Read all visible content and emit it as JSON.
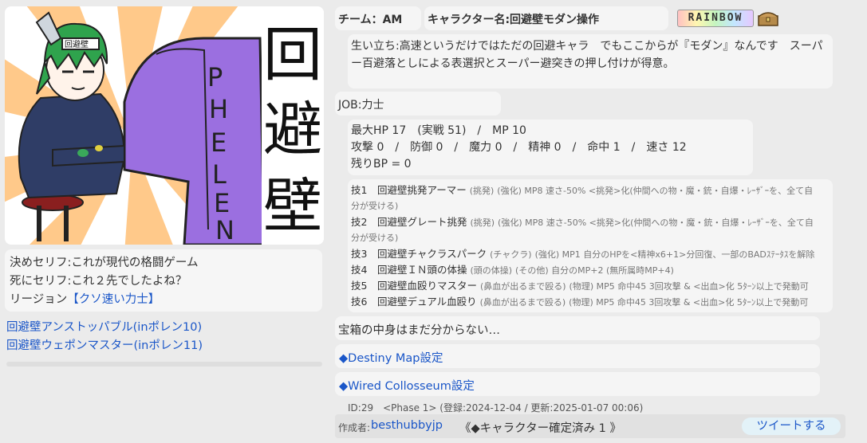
{
  "header": {
    "team": "チーム：AM",
    "character_name": "キャラクター名:回避壁モダン操作",
    "rank_badge": "RAINBOW"
  },
  "portrait": {
    "title_glyphs": [
      "回",
      "避",
      "壁"
    ],
    "vertical_word": [
      "P",
      "H",
      "E",
      "L",
      "E",
      "N"
    ],
    "headband_text": "回避壁"
  },
  "profile": {
    "bio": "生い立ち:高速というだけではただの回避キャラ　でもここからが『モダン』なんです　スーパー百避落としによる表選択とスーパー避突きの押し付けが得意。"
  },
  "quotes": {
    "win_quote": "決めセリフ:これが現代の格闘ゲーム",
    "death_quote": "死にセリフ:これ２先でしたよね？",
    "region_label": "リージョン",
    "region_value": "【クソ速い力士】"
  },
  "links": [
    "回避壁アンストッパブル(inポレン10)",
    "回避壁ウェポンマスター(inポレン11)"
  ],
  "job": "JOB:力士",
  "stats": {
    "line1": "最大HP 17　(実戦 51)　/　MP 10",
    "line2": "攻撃 0　/　防御 0　/　魔力 0　/　精神 0　/　命中 1　/　速さ 12",
    "line3": "残りBP = 0"
  },
  "skills": [
    {
      "label": "技1",
      "name": "回避壁挑発アーマー",
      "type": "(挑発)",
      "desc": "(強化) MP8 速さ-50% <挑発>化(仲間への物・魔・銃・自爆・ﾚｰｻﾞｰを、全て自",
      "wrap": "分が受ける)"
    },
    {
      "label": "技2",
      "name": "回避壁グレート挑発",
      "type": "(挑発)",
      "desc": "(強化) MP8 速さ-50% <挑発>化(仲間への物・魔・銃・自爆・ﾚｰｻﾞｰを、全て自",
      "wrap": "分が受ける)"
    },
    {
      "label": "技3",
      "name": "回避壁チャクラスパーク",
      "type": "(チャクラ)",
      "desc": "(強化) MP1 自分のHPを<精神x6+1>分回復、一部のBADｽﾃｰﾀｽを解除",
      "wrap": ""
    },
    {
      "label": "技4",
      "name": "回避壁ＩＮ頭の体操",
      "type": "(頭の体操)",
      "desc": "(その他) 自分のMP+2 (無所属時MP+4)",
      "wrap": ""
    },
    {
      "label": "技5",
      "name": "回避壁血殴りマスター",
      "type": "(鼻血が出るまで殴る)",
      "desc": "(物理) MP5 命中45 3回攻撃 & <出血>化 5ﾀｰﾝ以上で発動可",
      "wrap": ""
    },
    {
      "label": "技6",
      "name": "回避壁デュアル血殴り",
      "type": "(鼻血が出るまで殴る)",
      "desc": "(物理) MP5 命中45 3回攻撃 & <出血>化 5ﾀｰﾝ以上で発動可",
      "wrap": ""
    }
  ],
  "treasure": "宝箱の中身はまだ分からない…",
  "sections": [
    "◆Destiny Map設定",
    "◆Wired Collosseum設定"
  ],
  "meta": {
    "id_line": "ID:29　<Phase 1> (登録:2024-12-04 / 更新:2025-01-07 00:06)",
    "author_label": "作成者:",
    "author": "besthubbyjp",
    "status": "《◆キャラクター確定済み 1 》",
    "tweet": "ツイートする"
  },
  "colors": {
    "link": "#1a56c8",
    "arcade_purple": "#9b6fe0",
    "sunburst": "#ffc98a",
    "tweet_bg": "#e3f2f8"
  }
}
